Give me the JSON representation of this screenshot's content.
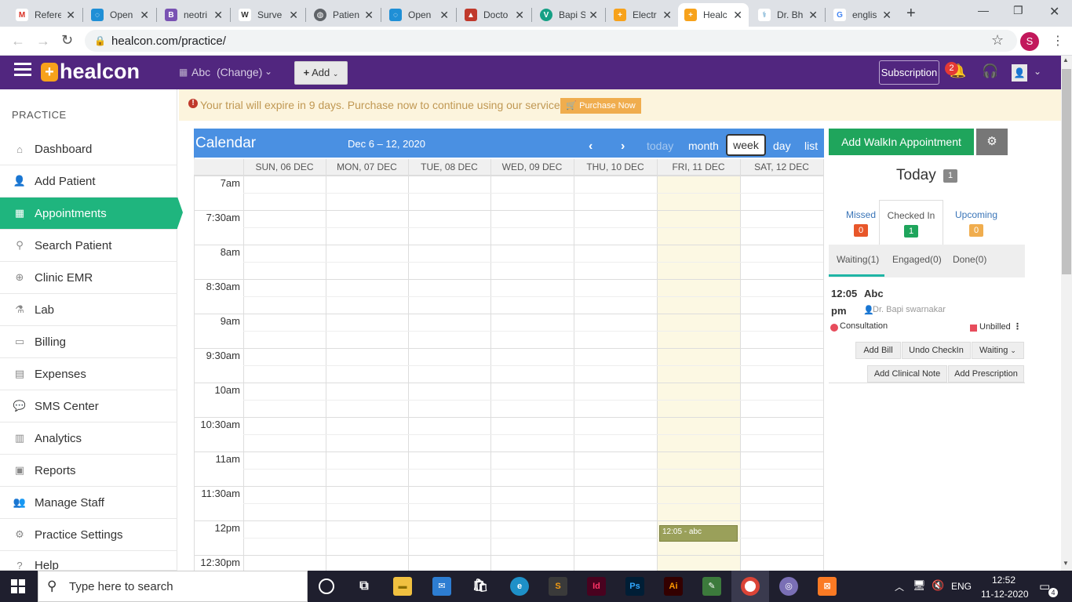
{
  "browser": {
    "tabs": [
      {
        "label": "Refere",
        "favicon": "gmail-icon",
        "color": "#d93025",
        "glyph": "M"
      },
      {
        "label": "Open",
        "favicon": "openemr-icon",
        "color": "#1f8fd6",
        "glyph": "◌"
      },
      {
        "label": "neotri",
        "favicon": "bootstrap-icon",
        "color": "#7952b3",
        "glyph": "B"
      },
      {
        "label": "Surve",
        "favicon": "wikipedia-icon",
        "color": "#333333",
        "glyph": "W"
      },
      {
        "label": "Patien",
        "favicon": "globe-icon",
        "color": "#5f6368",
        "glyph": "◍"
      },
      {
        "label": "Open",
        "favicon": "openemr-icon",
        "color": "#1f8fd6",
        "glyph": "◌"
      },
      {
        "label": "Docto",
        "favicon": "doctor-icon",
        "color": "#c0392b",
        "glyph": "▲"
      },
      {
        "label": "Bapi S",
        "favicon": "vue-icon",
        "color": "#16a085",
        "glyph": "V"
      },
      {
        "label": "Electr",
        "favicon": "healcon-icon",
        "color": "#f7a21b",
        "glyph": "+"
      },
      {
        "label": "Healc",
        "favicon": "healcon-icon",
        "color": "#f7a21b",
        "glyph": "+",
        "active": true
      },
      {
        "label": "Dr. Bh",
        "favicon": "medical-icon",
        "color": "#2980b9",
        "glyph": "⚕"
      },
      {
        "label": "englis",
        "favicon": "google-icon",
        "color": "#4285f4",
        "glyph": "G"
      }
    ],
    "url": "healcon.com/practice/",
    "profile_initial": "S"
  },
  "header": {
    "brand": "healcon",
    "clinic": "Abc",
    "change_label": "(Change)",
    "add_label": "Add",
    "subscription_label": "Subscription",
    "notification_count": "2"
  },
  "sidebar": {
    "section_title": "PRACTICE",
    "items": [
      {
        "label": "Dashboard",
        "icon": "home-icon",
        "glyph": "⌂"
      },
      {
        "label": "Add Patient",
        "icon": "user-plus-icon",
        "glyph": "👤"
      },
      {
        "label": "Appointments",
        "icon": "calendar-icon",
        "glyph": "▦",
        "active": true
      },
      {
        "label": "Search Patient",
        "icon": "search-icon",
        "glyph": "⚲"
      },
      {
        "label": "Clinic EMR",
        "icon": "plus-circle-icon",
        "glyph": "⊕"
      },
      {
        "label": "Lab",
        "icon": "flask-icon",
        "glyph": "⚗"
      },
      {
        "label": "Billing",
        "icon": "money-icon",
        "glyph": "▭"
      },
      {
        "label": "Expenses",
        "icon": "table-icon",
        "glyph": "▤"
      },
      {
        "label": "SMS Center",
        "icon": "comments-icon",
        "glyph": "💬"
      },
      {
        "label": "Analytics",
        "icon": "bar-chart-icon",
        "glyph": "▥"
      },
      {
        "label": "Reports",
        "icon": "book-icon",
        "glyph": "▣"
      },
      {
        "label": "Manage Staff",
        "icon": "users-icon",
        "glyph": "👥"
      },
      {
        "label": "Practice Settings",
        "icon": "cogs-icon",
        "glyph": "⚙"
      },
      {
        "label": "Help",
        "icon": "help-icon",
        "glyph": "?"
      }
    ]
  },
  "trial": {
    "message": "Your trial will expire in 9 days. Purchase now to continue using our services.",
    "purchase_label": "Purchase Now"
  },
  "calendar": {
    "title": "Calendar",
    "range": "Dec 6 – 12, 2020",
    "today_label": "today",
    "month_label": "month",
    "week_label": "week",
    "day_label": "day",
    "list_label": "list",
    "days": [
      "SUN, 06 DEC",
      "MON, 07 DEC",
      "TUE, 08 DEC",
      "WED, 09 DEC",
      "THU, 10 DEC",
      "FRI, 11 DEC",
      "SAT, 12 DEC"
    ],
    "times": [
      "7am",
      "7:30am",
      "8am",
      "8:30am",
      "9am",
      "9:30am",
      "10am",
      "10:30am",
      "11am",
      "11:30am",
      "12pm",
      "12:30pm"
    ],
    "event_label": "12:05 - abc"
  },
  "panel": {
    "walkin_label": "Add WalkIn Appointment",
    "today_label": "Today",
    "today_count": "1",
    "missed_label": "Missed",
    "missed_count": "0",
    "checkedin_label": "Checked In",
    "checkedin_count": "1",
    "upcoming_label": "Upcoming",
    "upcoming_count": "0",
    "waiting_tab": "Waiting(1)",
    "engaged_tab": "Engaged(0)",
    "done_tab": "Done(0)",
    "appt_time_a": "12:05",
    "appt_time_b": "pm",
    "appt_patient": "Abc",
    "appt_doctor": "Dr. Bapi swarnakar",
    "appt_type": "Consultation",
    "appt_billing": "Unbilled",
    "add_bill": "Add Bill",
    "undo_checkin": "Undo CheckIn",
    "waiting_select": "Waiting",
    "add_note": "Add Clinical Note",
    "add_prescription": "Add Prescription"
  },
  "taskbar": {
    "search_placeholder": "Type here to search",
    "language": "ENG",
    "time": "12:52",
    "date": "11-12-2020",
    "notifications": "4"
  },
  "colors": {
    "header": "#51267f",
    "accent_green": "#1fb57e",
    "calendar_blue": "#4a90e2"
  }
}
